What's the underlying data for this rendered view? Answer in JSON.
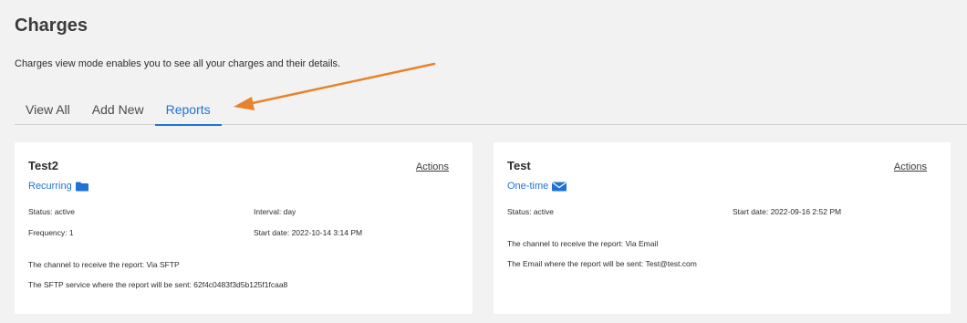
{
  "page": {
    "title": "Charges",
    "subtitle": "Charges view mode enables you to see all your charges and their details."
  },
  "tabs": [
    {
      "label": "View All"
    },
    {
      "label": "Add New"
    },
    {
      "label": "Reports"
    }
  ],
  "active_tab": "Reports",
  "annotation": {
    "arrow_color": "#e8822c"
  },
  "cards": [
    {
      "title": "Test2",
      "actions_label": "Actions",
      "type_label": "Recurring",
      "type_icon": "folder-icon",
      "status": "Status: active",
      "interval": "Interval: day",
      "frequency": "Frequency: 1",
      "start_date": "Start date: 2022-10-14 3:14 PM",
      "channel": "The channel to receive the report: Via SFTP",
      "destination": "The SFTP service where the report will be sent: 62f4c0483f3d5b125f1fcaa8"
    },
    {
      "title": "Test",
      "actions_label": "Actions",
      "type_label": "One-time",
      "type_icon": "envelope-icon",
      "status": "Status: active",
      "start_date": "Start date: 2022-09-16 2:52 PM",
      "channel": "The channel to receive the report: Via Email",
      "destination": "The Email where the report will be sent: Test@test.com"
    }
  ],
  "colors": {
    "accent": "#1f73d8",
    "background": "#f2f2f2",
    "card": "#ffffff"
  }
}
